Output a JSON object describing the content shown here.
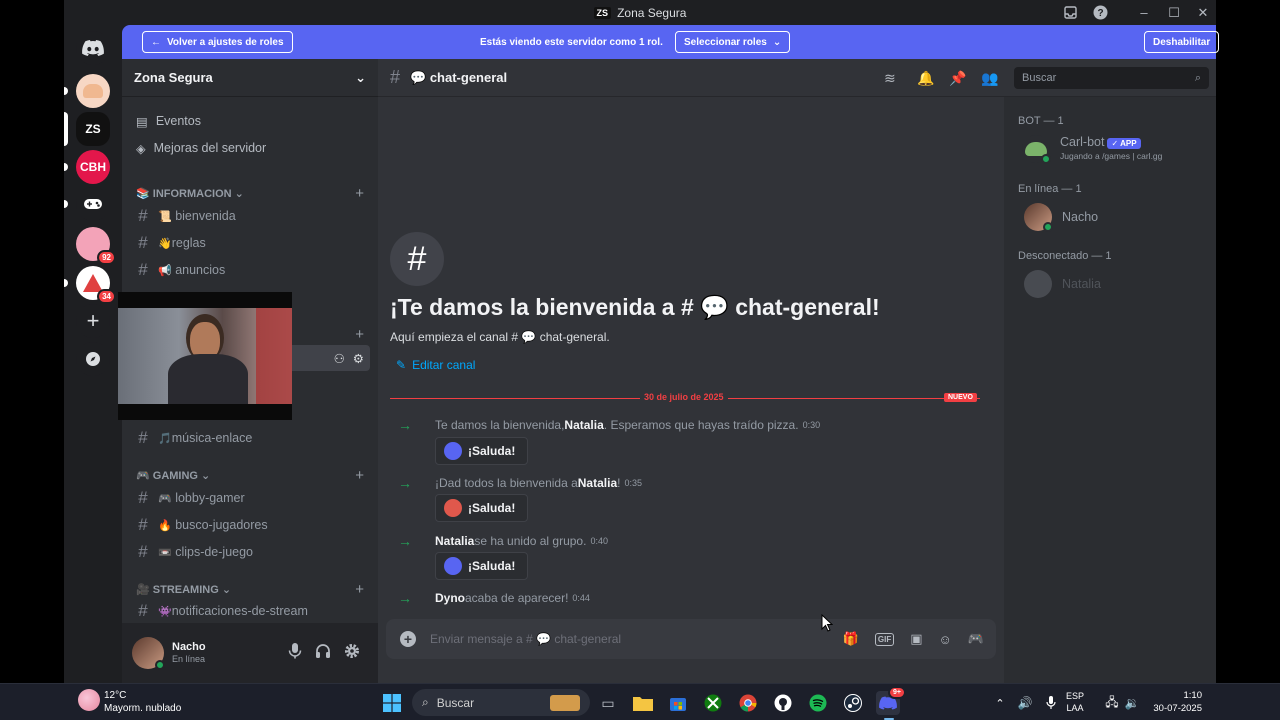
{
  "window": {
    "title": "Zona Segura",
    "logo": "ZS"
  },
  "banner": {
    "back_label": "Volver a ajustes de roles",
    "viewing_text": "Estás viendo este servidor como 1 rol.",
    "select_label": "Seleccionar roles",
    "disable_label": "Deshabilitar"
  },
  "rail": {
    "servers": [
      {
        "label": "",
        "badge": ""
      },
      {
        "label": "ZS",
        "badge": ""
      },
      {
        "label": "CBH",
        "badge": ""
      },
      {
        "label": "",
        "badge": ""
      },
      {
        "label": "",
        "badge": "92"
      },
      {
        "label": "",
        "badge": "34"
      }
    ]
  },
  "sidebar": {
    "server_name": "Zona Segura",
    "events": "Eventos",
    "boosts": "Mejoras del servidor",
    "categories": {
      "info": "INFORMACION",
      "gaming": "GAMING",
      "streaming": "STREAMING"
    },
    "channels": {
      "bienvenida": "bienvenida",
      "reglas": "reglas",
      "anuncios": "anuncios",
      "musica": "música-enlace",
      "lobby": "lobby-gamer",
      "busco": "busco-jugadores",
      "clips": "clips-de-juego",
      "notif": "notificaciones-de-stream"
    },
    "emojis": {
      "bienvenida": "📜",
      "reglas": "👋",
      "anuncios": "📢",
      "musica": "🎵",
      "lobby": "🎮",
      "busco": "🔥",
      "clips": "📼",
      "notif": "👾"
    }
  },
  "user": {
    "name": "Nacho",
    "status": "En línea"
  },
  "chat": {
    "channel_name": "chat-general",
    "channel_emoji": "💬",
    "welcome_title": "¡Te damos la bienvenida a # 💬 chat-general!",
    "welcome_sub": "Aquí empieza el canal # 💬 chat-general.",
    "edit_channel": "Editar canal",
    "date_divider": "30 de julio de 2025",
    "new_label": "NUEVO",
    "messages": [
      {
        "pre": "Te damos la bienvenida, ",
        "name": "Natalia",
        "post": ". Esperamos que hayas traído pizza.",
        "time": "0:30"
      },
      {
        "pre": "¡Dad todos la bienvenida a ",
        "name": "Natalia",
        "post": "!",
        "time": "0:35"
      },
      {
        "pre": "",
        "name": "Natalia",
        "post": " se ha unido al grupo.",
        "time": "0:40"
      },
      {
        "pre": "",
        "name": "Dyno",
        "post": " acaba de aparecer!",
        "time": "0:44"
      }
    ],
    "wave_label": "¡Saluda!",
    "composer_placeholder": "Enviar mensaje a # 💬 chat-general",
    "search_placeholder": "Buscar"
  },
  "members": {
    "bot_cat": "BOT — 1",
    "bot_name": "Carl-bot",
    "bot_tag": "✓ APP",
    "bot_activity": "Jugando a /games | carl.gg",
    "online_cat": "En línea — 1",
    "online_name": "Nacho",
    "offline_cat": "Desconectado — 1",
    "offline_name": "Natalia"
  },
  "taskbar": {
    "weather_temp": "12°C",
    "weather_desc": "Mayorm. nublado",
    "search": "Buscar",
    "lang1": "ESP",
    "lang2": "LAA",
    "time": "1:10",
    "date": "30-07-2025",
    "discord_badge": "9+"
  },
  "colors": {
    "accent": "#5865f2",
    "online": "#23a55a",
    "danger": "#f23f43",
    "link": "#00a8fc"
  }
}
